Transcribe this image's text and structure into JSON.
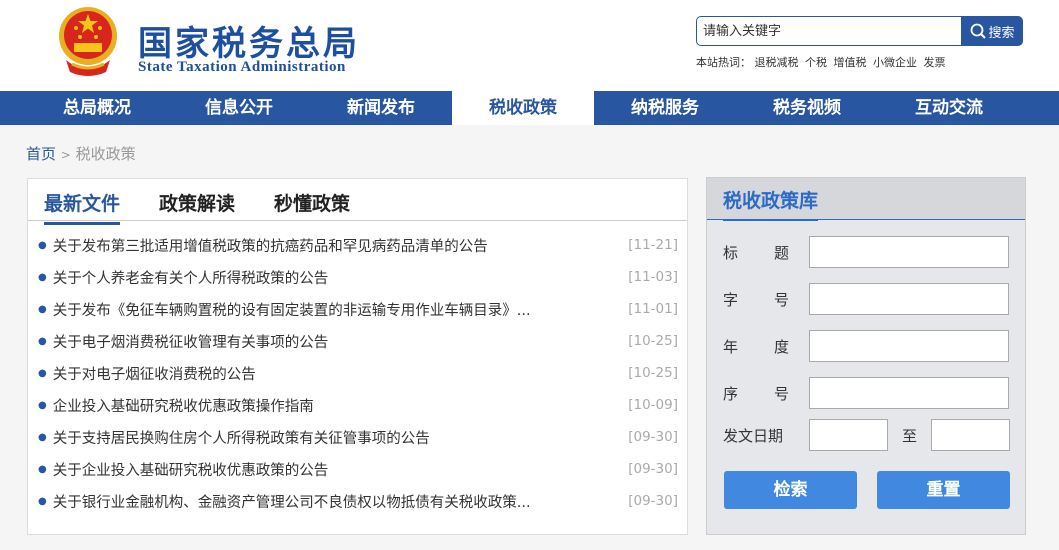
{
  "header": {
    "logo_cn": "国家税务总局",
    "logo_en": "State Taxation Administration",
    "search_placeholder": "请输入关键字",
    "search_button": "搜索",
    "hot_label": "本站热词：",
    "hot_words": [
      "退税减税",
      "个税",
      "增值税",
      "小微企业",
      "发票"
    ]
  },
  "nav": [
    "总局概况",
    "信息公开",
    "新闻发布",
    "税收政策",
    "纳税服务",
    "税务视频",
    "互动交流"
  ],
  "nav_active": 3,
  "breadcrumb": {
    "home": "首页",
    "sep": ">",
    "current": "税收政策"
  },
  "tabs": [
    "最新文件",
    "政策解读",
    "秒懂政策"
  ],
  "list": [
    {
      "title": "关于发布第三批适用增值税政策的抗癌药品和罕见病药品清单的公告",
      "date": "[11-21]"
    },
    {
      "title": "关于个人养老金有关个人所得税政策的公告",
      "date": "[11-03]"
    },
    {
      "title": "关于发布《免征车辆购置税的设有固定装置的非运输专用作业车辆目录》...",
      "date": "[11-01]"
    },
    {
      "title": "关于电子烟消费税征收管理有关事项的公告",
      "date": "[10-25]"
    },
    {
      "title": "关于对电子烟征收消费税的公告",
      "date": "[10-25]"
    },
    {
      "title": "企业投入基础研究税收优惠政策操作指南",
      "date": "[10-09]"
    },
    {
      "title": "关于支持居民换购住房个人所得税政策有关征管事项的公告",
      "date": "[09-30]"
    },
    {
      "title": "关于企业投入基础研究税收优惠政策的公告",
      "date": "[09-30]"
    },
    {
      "title": "关于银行业金融机构、金融资产管理公司不良债权以物抵债有关税收政策...",
      "date": "[09-30]"
    }
  ],
  "policy_lib": {
    "title": "税收政策库",
    "fields": [
      [
        "标",
        "题"
      ],
      [
        "字",
        "号"
      ],
      [
        "年",
        "度"
      ],
      [
        "序",
        "号"
      ]
    ],
    "date_label": "发文日期",
    "to": "至",
    "search": "检索",
    "reset": "重置"
  },
  "colors": {
    "brand": "#2856a0",
    "button": "#4189e0"
  }
}
